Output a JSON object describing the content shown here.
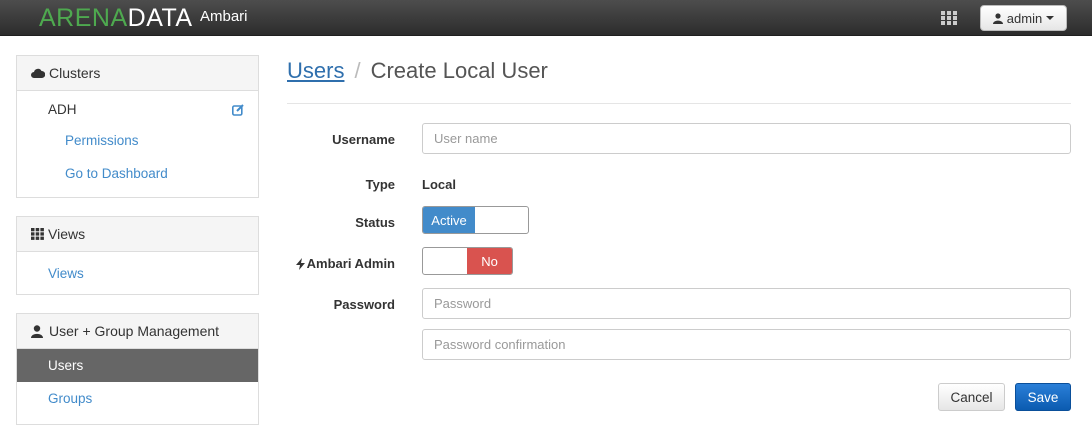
{
  "topbar": {
    "logo_part1": "ARENA",
    "logo_part2": "DATA",
    "app_name": "Ambari",
    "user_menu": "admin"
  },
  "sidebar": {
    "clusters": {
      "header": "Clusters",
      "cluster_name": "ADH",
      "items": [
        "Permissions",
        "Go to Dashboard"
      ]
    },
    "views": {
      "header": "Views",
      "items": [
        "Views"
      ]
    },
    "user_group": {
      "header": "User + Group Management",
      "items": [
        "Users",
        "Groups"
      ],
      "active": "Users"
    }
  },
  "page": {
    "breadcrumb_link": "Users",
    "separator": "/",
    "title": "Create Local User"
  },
  "form": {
    "username_label": "Username",
    "username_placeholder": "User name",
    "type_label": "Type",
    "type_value": "Local",
    "status_label": "Status",
    "status_value": "Active",
    "admin_label": "Ambari Admin",
    "admin_value": "No",
    "password_label": "Password",
    "password_placeholder": "Password",
    "password_confirm_placeholder": "Password confirmation",
    "cancel_label": "Cancel",
    "save_label": "Save"
  },
  "colors": {
    "accent": "#428bca",
    "danger": "#d9534f",
    "primary": "#0b5bb0",
    "brand_green": "#4ea94f"
  }
}
